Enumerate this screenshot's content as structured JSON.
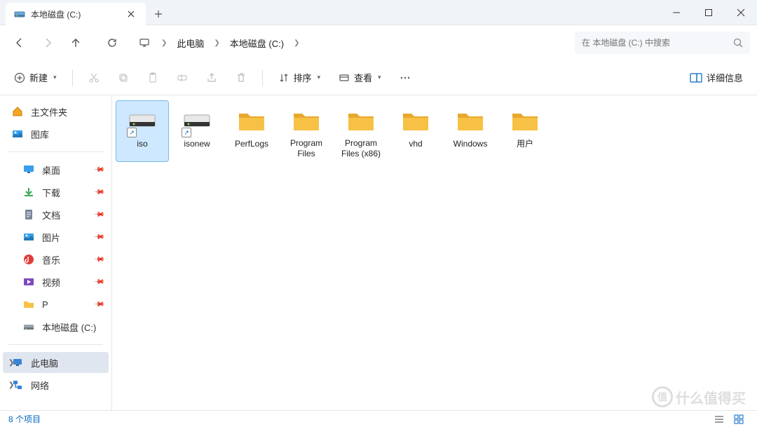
{
  "tab": {
    "title": "本地磁盘 (C:)"
  },
  "breadcrumbs": [
    "此电脑",
    "本地磁盘 (C:)"
  ],
  "search": {
    "placeholder": "在 本地磁盘 (C:) 中搜索"
  },
  "toolbar": {
    "new_label": "新建",
    "sort_label": "排序",
    "view_label": "查看",
    "details_label": "详细信息"
  },
  "sidebar": {
    "home": "主文件夹",
    "gallery": "图库",
    "desktop": "桌面",
    "downloads": "下载",
    "documents": "文档",
    "pictures": "图片",
    "music": "音乐",
    "videos": "视频",
    "p_folder": "P",
    "cdrive": "本地磁盘 (C:)",
    "thispc": "此电脑",
    "network": "网络"
  },
  "items": [
    {
      "name": "iso",
      "type": "drive-shortcut"
    },
    {
      "name": "isonew",
      "type": "drive-shortcut"
    },
    {
      "name": "PerfLogs",
      "type": "folder"
    },
    {
      "name": "Program Files",
      "type": "folder"
    },
    {
      "name": "Program Files (x86)",
      "type": "folder"
    },
    {
      "name": "vhd",
      "type": "folder"
    },
    {
      "name": "Windows",
      "type": "folder"
    },
    {
      "name": "用户",
      "type": "folder"
    }
  ],
  "status": {
    "count": "8 个项目"
  },
  "watermark": "什么值得买"
}
